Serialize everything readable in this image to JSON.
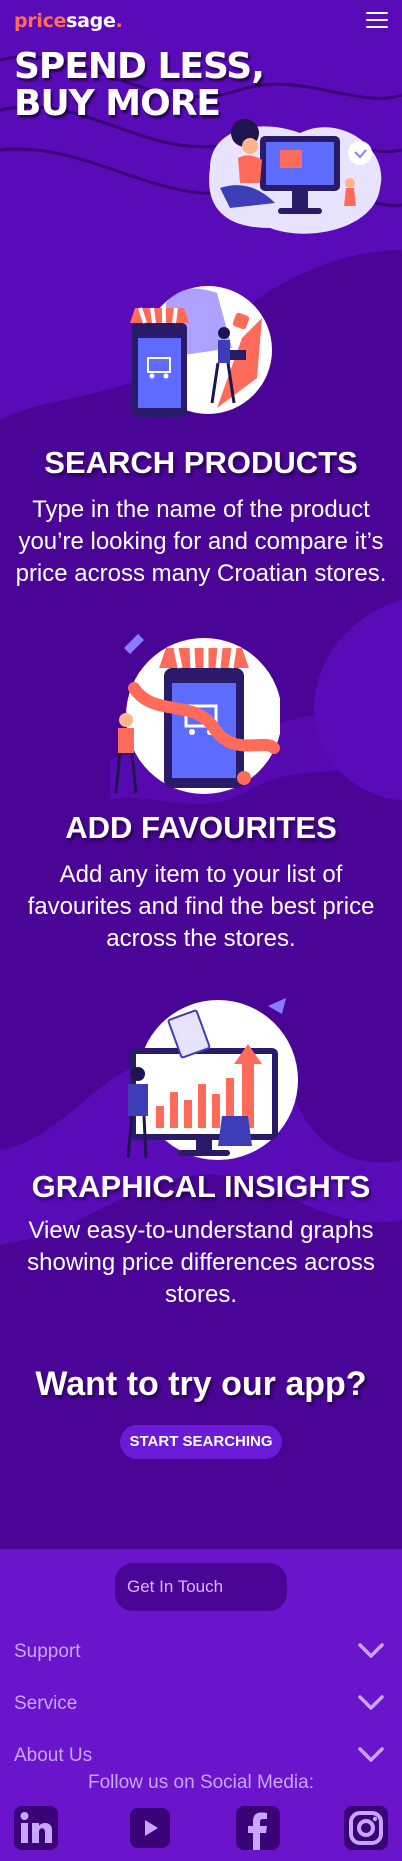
{
  "brand": {
    "name_part1": "price",
    "name_part2": "sage",
    "name_dot": "."
  },
  "hero": {
    "title_line1": "SPEND LESS,",
    "title_line2": "BUY MORE"
  },
  "features": [
    {
      "title": "SEARCH PRODUCTS",
      "description": "Type in the name of the product you’re looking for and compare it’s price across many Croatian stores."
    },
    {
      "title": "ADD FAVOURITES",
      "description": "Add any item to your list of favourites and find the best price across the stores."
    },
    {
      "title": "GRAPHICAL INSIGHTS",
      "description": "View easy-to-understand graphs showing price differences across stores."
    }
  ],
  "cta": {
    "title": "Want to try our app?",
    "button": "START SEARCHING"
  },
  "footer": {
    "contact_button": "Get In Touch",
    "accordion": [
      "Support",
      "Service",
      "About Us"
    ],
    "follow_text": "Follow us on Social Media:",
    "social": [
      "linkedin-icon",
      "youtube-icon",
      "facebook-icon",
      "instagram-icon"
    ]
  },
  "colors": {
    "accent": "#ff6b5a",
    "bg_dark": "#4a0596",
    "bg_mid": "#5a0bb8",
    "footer": "#6a14cc"
  }
}
